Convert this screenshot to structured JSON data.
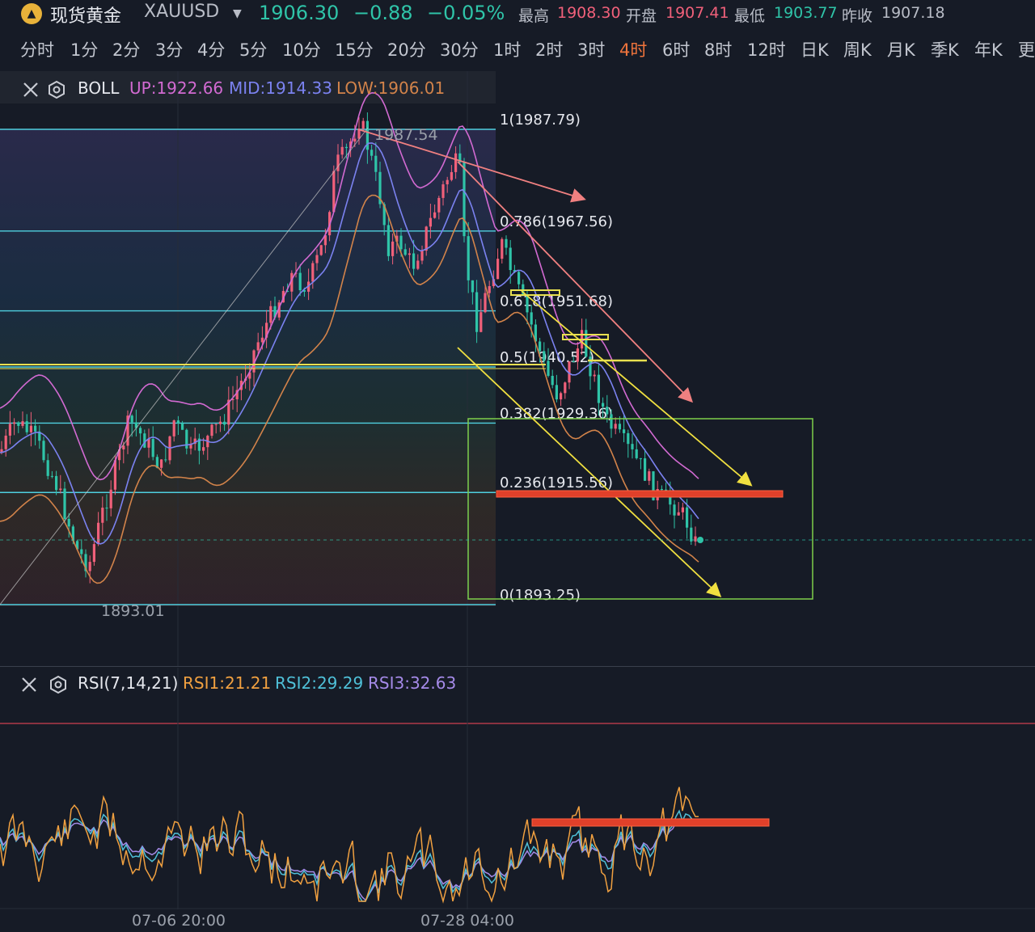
{
  "header": {
    "name": "现货黄金",
    "symbol": "XAUUSD",
    "price": "1906.30",
    "change": "−0.88",
    "change_pct": "−0.05%",
    "high_label": "最高",
    "high": "1908.30",
    "open_label": "开盘",
    "open": "1907.41",
    "low_label": "最低",
    "low": "1903.77",
    "prev_label": "昨收",
    "prev": "1907.18"
  },
  "timeframes": [
    "分时",
    "1分",
    "2分",
    "3分",
    "4分",
    "5分",
    "10分",
    "15分",
    "20分",
    "30分",
    "1时",
    "2时",
    "3时",
    "4时",
    "6时",
    "8时",
    "12时",
    "日K",
    "周K",
    "月K",
    "季K",
    "年K",
    "更"
  ],
  "active_timeframe": "4时",
  "boll": {
    "title": "BOLL",
    "up": "UP:1922.66",
    "mid": "MID:1914.33",
    "low": "LOW:1906.01"
  },
  "rsi": {
    "title": "RSI(7,14,21)",
    "rsi1": "RSI1:21.21",
    "rsi2": "RSI2:29.29",
    "rsi3": "RSI3:32.63"
  },
  "fib_levels": [
    {
      "label": "1(1987.79)",
      "value": 1987.79
    },
    {
      "label": "0.786(1967.56)",
      "value": 1967.56
    },
    {
      "label": "0.618(1951.68)",
      "value": 1951.68
    },
    {
      "label": "0.5(1940.52)",
      "value": 1940.52
    },
    {
      "label": "0.382(1929.36)",
      "value": 1929.36
    },
    {
      "label": "0.236(1915.56)",
      "value": 1915.56
    },
    {
      "label": "0(1893.25)",
      "value": 1893.25
    }
  ],
  "price_marks": {
    "high": "1987.54",
    "low": "1893.01"
  },
  "time_labels": [
    "07-06 20:00",
    "07-28 04:00"
  ],
  "colors": {
    "up": "#f0607a",
    "down": "#2fc4a8",
    "boll_up": "#d26ad2",
    "boll_mid": "#7b82f0",
    "boll_low": "#d2834a",
    "fib": "#4fd0e0",
    "accent": "#f0743c",
    "rsi1": "#f0a040",
    "rsi2": "#4fc0d8",
    "rsi3": "#a58ae8"
  }
}
